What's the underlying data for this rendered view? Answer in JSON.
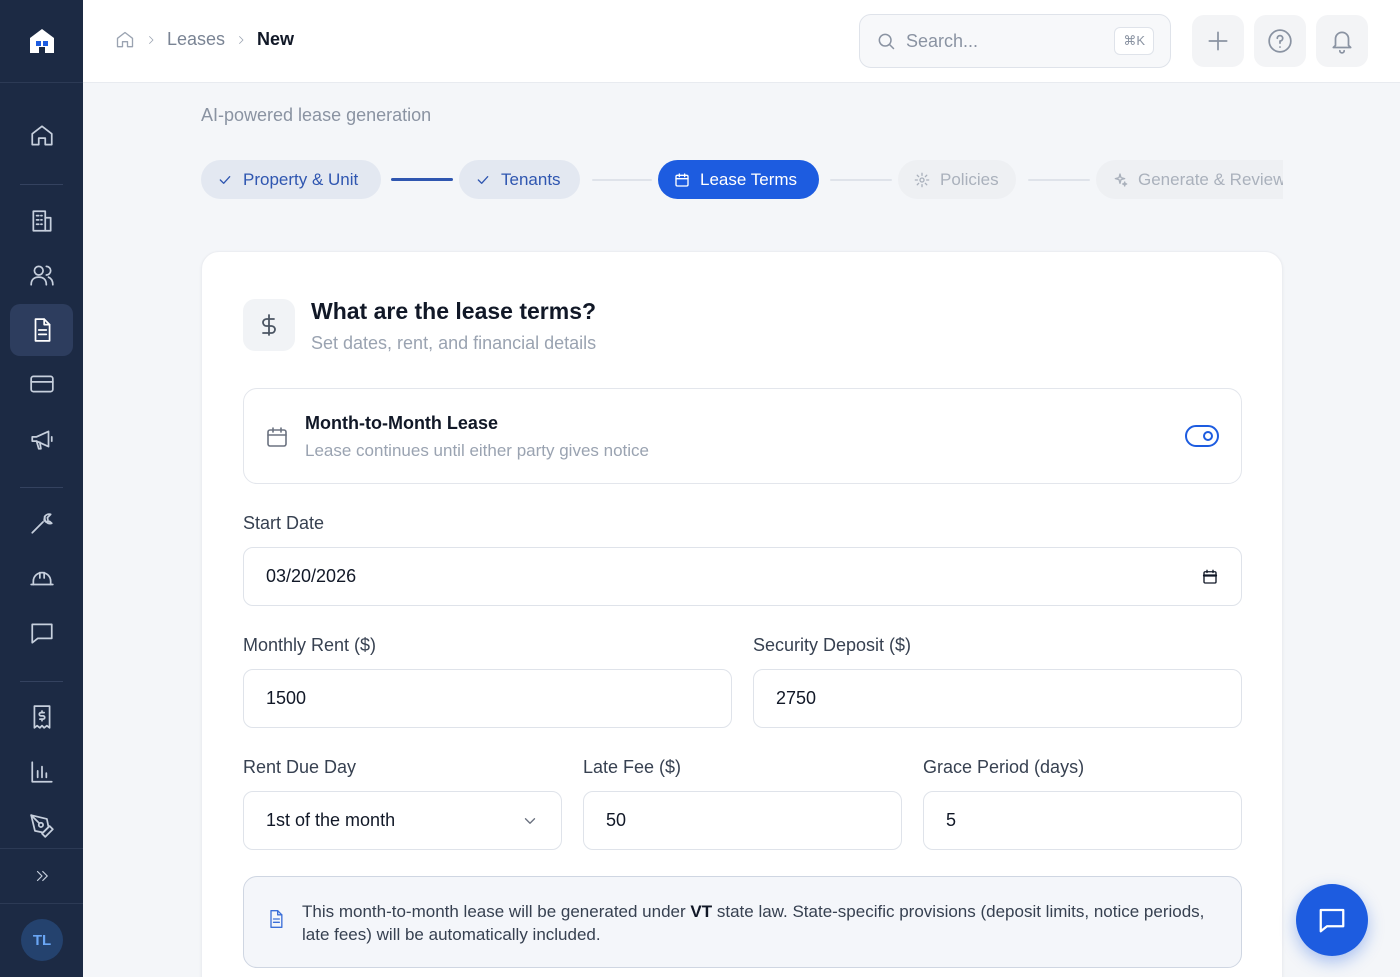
{
  "breadcrumb": {
    "home_icon": "home-icon",
    "items": [
      "Leases",
      "New"
    ]
  },
  "search": {
    "placeholder": "Search...",
    "shortcut": "⌘K"
  },
  "topbar_buttons": [
    "plus-icon",
    "help-icon",
    "bell-icon"
  ],
  "sidebar": {
    "items": [
      "home-icon",
      "building-icon",
      "users-icon",
      "document-icon",
      "credit-card-icon",
      "megaphone-icon",
      "wrench-icon",
      "hard-hat-icon",
      "message-icon",
      "receipt-icon",
      "chart-icon",
      "pen-tool-icon"
    ],
    "active": "document-icon",
    "avatar": "TL"
  },
  "page": {
    "subtitle": "AI-powered lease generation"
  },
  "steps": [
    {
      "label": "Property & Unit",
      "status": "done"
    },
    {
      "label": "Tenants",
      "status": "done"
    },
    {
      "label": "Lease Terms",
      "status": "active"
    },
    {
      "label": "Policies",
      "status": "pending"
    },
    {
      "label": "Generate & Review",
      "status": "pending"
    }
  ],
  "card": {
    "title": "What are the lease terms?",
    "subtitle": "Set dates, rent, and financial details",
    "month_to_month": {
      "title": "Month-to-Month Lease",
      "subtitle": "Lease continues until either party gives notice",
      "enabled": true
    },
    "start_date": {
      "label": "Start Date",
      "value": "03/20/2026"
    },
    "monthly_rent": {
      "label": "Monthly Rent ($)",
      "value": "1500"
    },
    "security_deposit": {
      "label": "Security Deposit ($)",
      "value": "2750"
    },
    "rent_due_day": {
      "label": "Rent Due Day",
      "value": "1st of the month"
    },
    "late_fee": {
      "label": "Late Fee ($)",
      "value": "50"
    },
    "grace_period": {
      "label": "Grace Period (days)",
      "value": "5"
    },
    "notice": {
      "prefix": "This month-to-month lease will be generated under",
      "state": "VT",
      "suffix": "state law. State-specific provisions (deposit limits, notice periods, late fees) will be automatically included."
    }
  },
  "colors": {
    "accent": "#1d5ce0",
    "sidebar": "#1c2a44"
  }
}
